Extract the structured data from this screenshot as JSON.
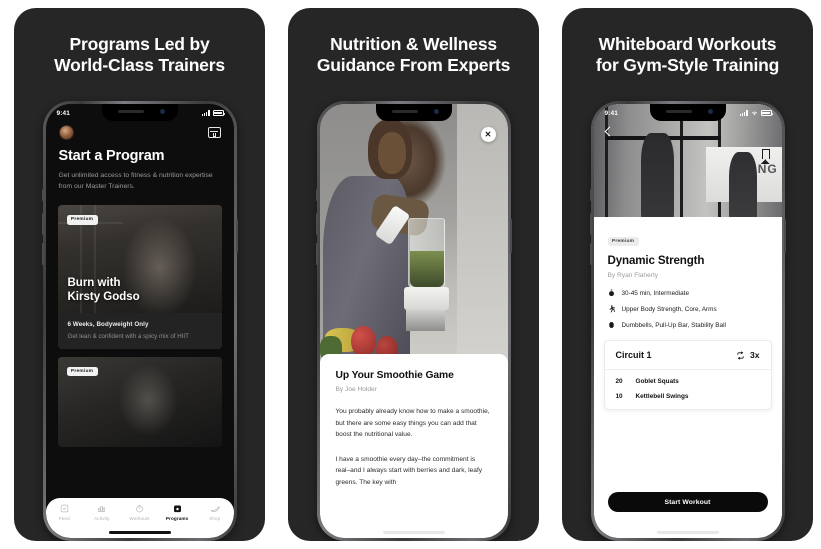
{
  "panels": [
    {
      "headline": "Programs Led by\nWorld-Class Trainers",
      "status": {
        "time": "9:41"
      },
      "screen": {
        "title": "Start a Program",
        "subtitle": "Get unlimited access to fitness & nutrition expertise from our Master Trainers.",
        "cards": [
          {
            "badge": "Premium",
            "title": "Burn with\nKirsty Godso",
            "meta_title": "6 Weeks, Bodyweight Only",
            "meta_desc": "Get lean & confident with a spicy mix of HIIT"
          },
          {
            "badge": "Premium",
            "title": "",
            "meta_title": "",
            "meta_desc": ""
          }
        ],
        "tabs": [
          {
            "label": "Feed",
            "icon": "feed-icon",
            "active": false
          },
          {
            "label": "Activity",
            "icon": "activity-icon",
            "active": false
          },
          {
            "label": "Workouts",
            "icon": "stopwatch-icon",
            "active": false
          },
          {
            "label": "Programs",
            "icon": "calendar-icon",
            "active": true
          },
          {
            "label": "Shop",
            "icon": "shoe-icon",
            "active": false
          }
        ]
      }
    },
    {
      "headline": "Nutrition & Wellness\nGuidance From Experts",
      "screen": {
        "close_label": "✕",
        "article_title": "Up Your Smoothie Game",
        "article_by": "By Joe Holder",
        "paragraphs": [
          "You probably already know how to make a smoothie, but there are some easy things you can add that boost the nutritional value.",
          "I have a smoothie every day–the commitment is real–and I always start with berries and dark, leafy greens. The key with"
        ]
      }
    },
    {
      "headline": "Whiteboard Workouts\nfor Gym-Style Training",
      "screen": {
        "gym_sign": "AINING",
        "badge": "Premium",
        "title": "Dynamic Strength",
        "by": "By Ryan Flaherty",
        "details": [
          {
            "icon": "stopwatch-icon",
            "text": "30-45 min, Intermediate"
          },
          {
            "icon": "runner-icon",
            "text": "Upper Body Strength, Core, Arms"
          },
          {
            "icon": "dumbbell-icon",
            "text": "Dumbbells, Pull-Up Bar, Stability Ball"
          }
        ],
        "circuit": {
          "title": "Circuit 1",
          "repeat": "3x",
          "exercises": [
            {
              "reps": "20",
              "name": "Goblet Squats"
            },
            {
              "reps": "10",
              "name": "Kettlebell Swings"
            }
          ]
        },
        "start_label": "Start Workout"
      }
    }
  ],
  "colors": {
    "panel_bg": "#262626",
    "page_bg": "#ffffff",
    "accent_dark": "#0a0a0a",
    "muted_text": "#9b9b9b"
  }
}
